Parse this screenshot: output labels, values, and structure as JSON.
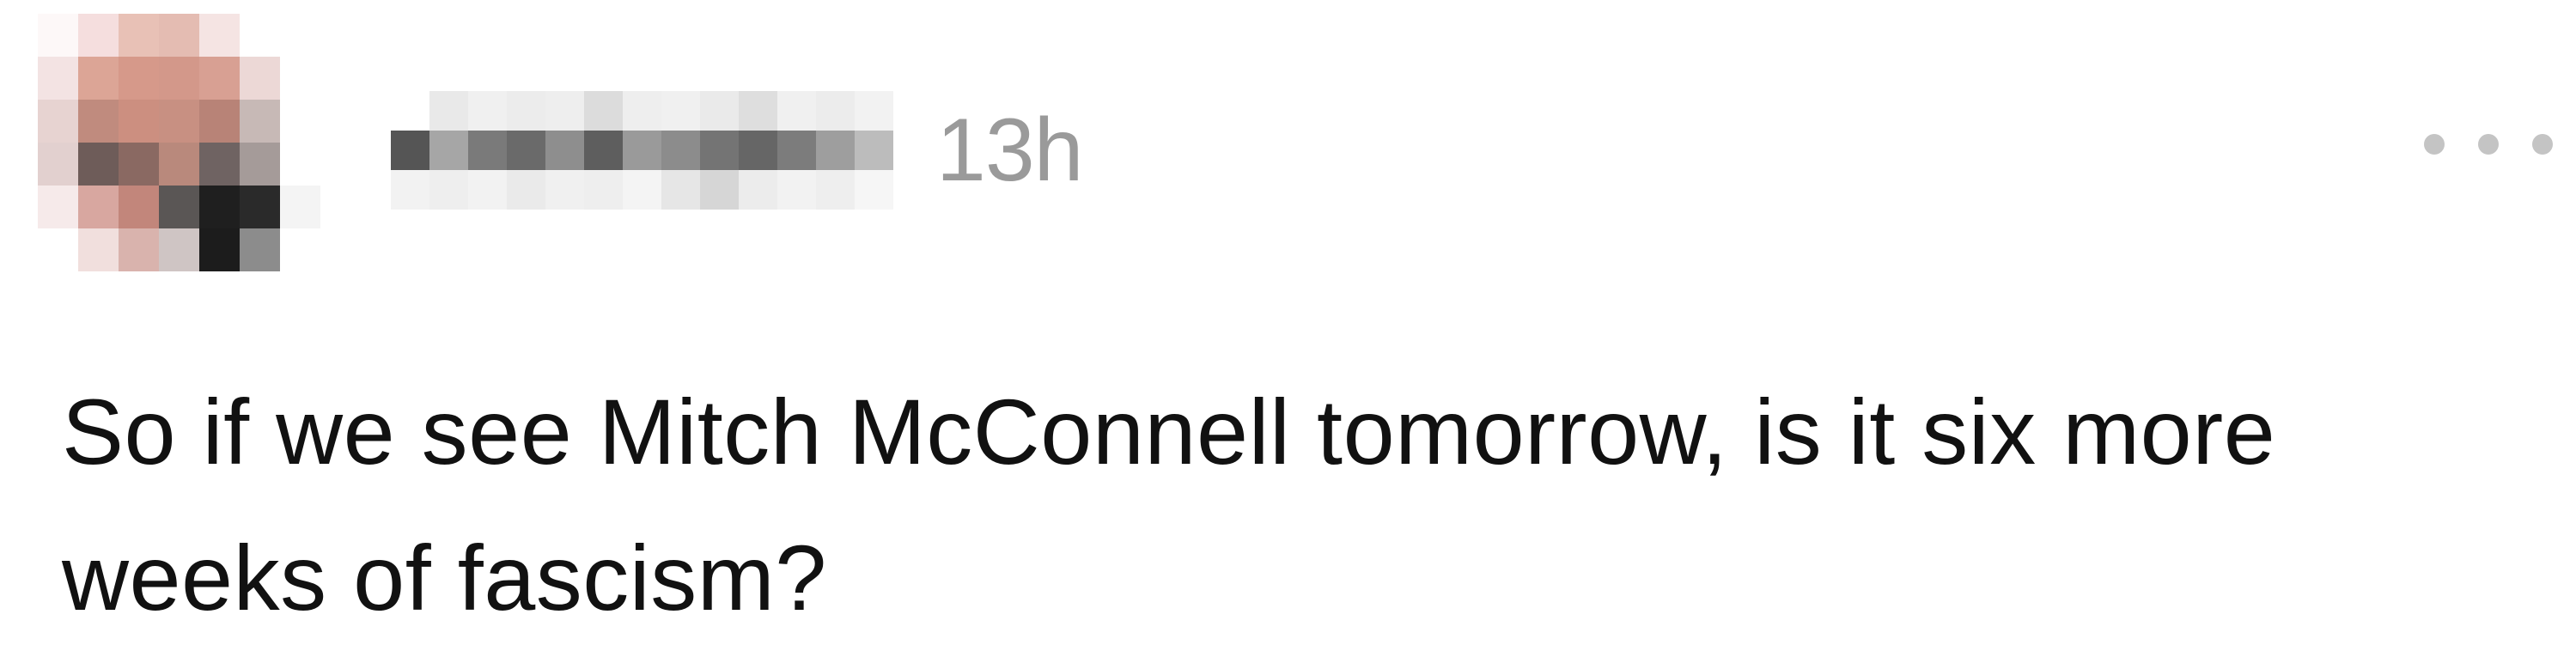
{
  "post": {
    "timestamp": "13h",
    "text": "So if we see Mitch McConnell tomorrow, is it six more weeks of fascism?",
    "more_icon": "more-horizontal-icon"
  },
  "colors": {
    "timestamp": "#9a9a9a",
    "text": "#111111",
    "more_dots": "#c4c4c4",
    "background": "#ffffff"
  }
}
